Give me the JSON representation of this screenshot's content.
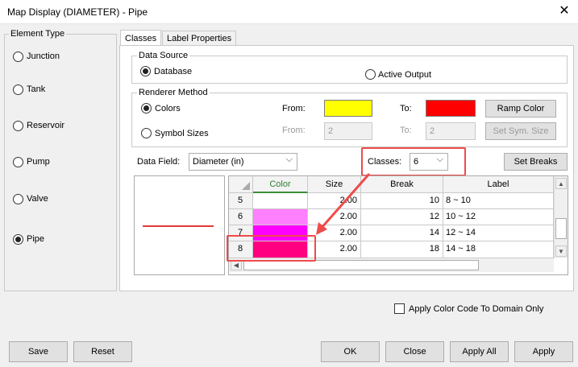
{
  "window": {
    "title": "Map Display (DIAMETER) - Pipe",
    "close_glyph": "✕"
  },
  "element_type": {
    "title": "Element Type",
    "items": [
      {
        "label": "Junction",
        "checked": false
      },
      {
        "label": "Tank",
        "checked": false
      },
      {
        "label": "Reservoir",
        "checked": false
      },
      {
        "label": "Pump",
        "checked": false
      },
      {
        "label": "Valve",
        "checked": false
      },
      {
        "label": "Pipe",
        "checked": true
      }
    ]
  },
  "tabs": {
    "classes": "Classes",
    "label_properties": "Label Properties"
  },
  "data_source": {
    "title": "Data Source",
    "database": "Database",
    "active_output": "Active Output"
  },
  "renderer": {
    "title": "Renderer Method",
    "colors": "Colors",
    "symbol_sizes": "Symbol Sizes",
    "from_label": "From:",
    "to_label": "To:",
    "from_color": "#ffff00",
    "to_color": "#ff0000",
    "ramp_color": "Ramp Color",
    "size_from": "2",
    "size_to": "2",
    "set_sym_size": "Set Sym. Size"
  },
  "data_field": {
    "label": "Data Field:",
    "value": "Diameter (in)"
  },
  "classes": {
    "label": "Classes:",
    "value": "6"
  },
  "set_breaks": "Set Breaks",
  "legend_line_color": "#e53935",
  "table": {
    "headers": {
      "color": "Color",
      "size": "Size",
      "break": "Break",
      "label": "Label"
    },
    "rows": [
      {
        "num": "5",
        "color": "#ffffff",
        "size": "2.00",
        "break": "10",
        "label": "8 ~ 10"
      },
      {
        "num": "6",
        "color": "#ff80ff",
        "size": "2.00",
        "break": "12",
        "label": "10 ~ 12"
      },
      {
        "num": "7",
        "color": "#ff00ff",
        "size": "2.00",
        "break": "14",
        "label": "12 ~ 14"
      },
      {
        "num": "8",
        "color": "#ff0080",
        "size": "2.00",
        "break": "18",
        "label": "14 ~ 18"
      }
    ]
  },
  "apply_domain": "Apply Color Code To Domain Only",
  "buttons": {
    "save": "Save",
    "reset": "Reset",
    "ok": "OK",
    "close": "Close",
    "apply_all": "Apply All",
    "apply": "Apply"
  },
  "annotation_color": "#ef4b4b"
}
